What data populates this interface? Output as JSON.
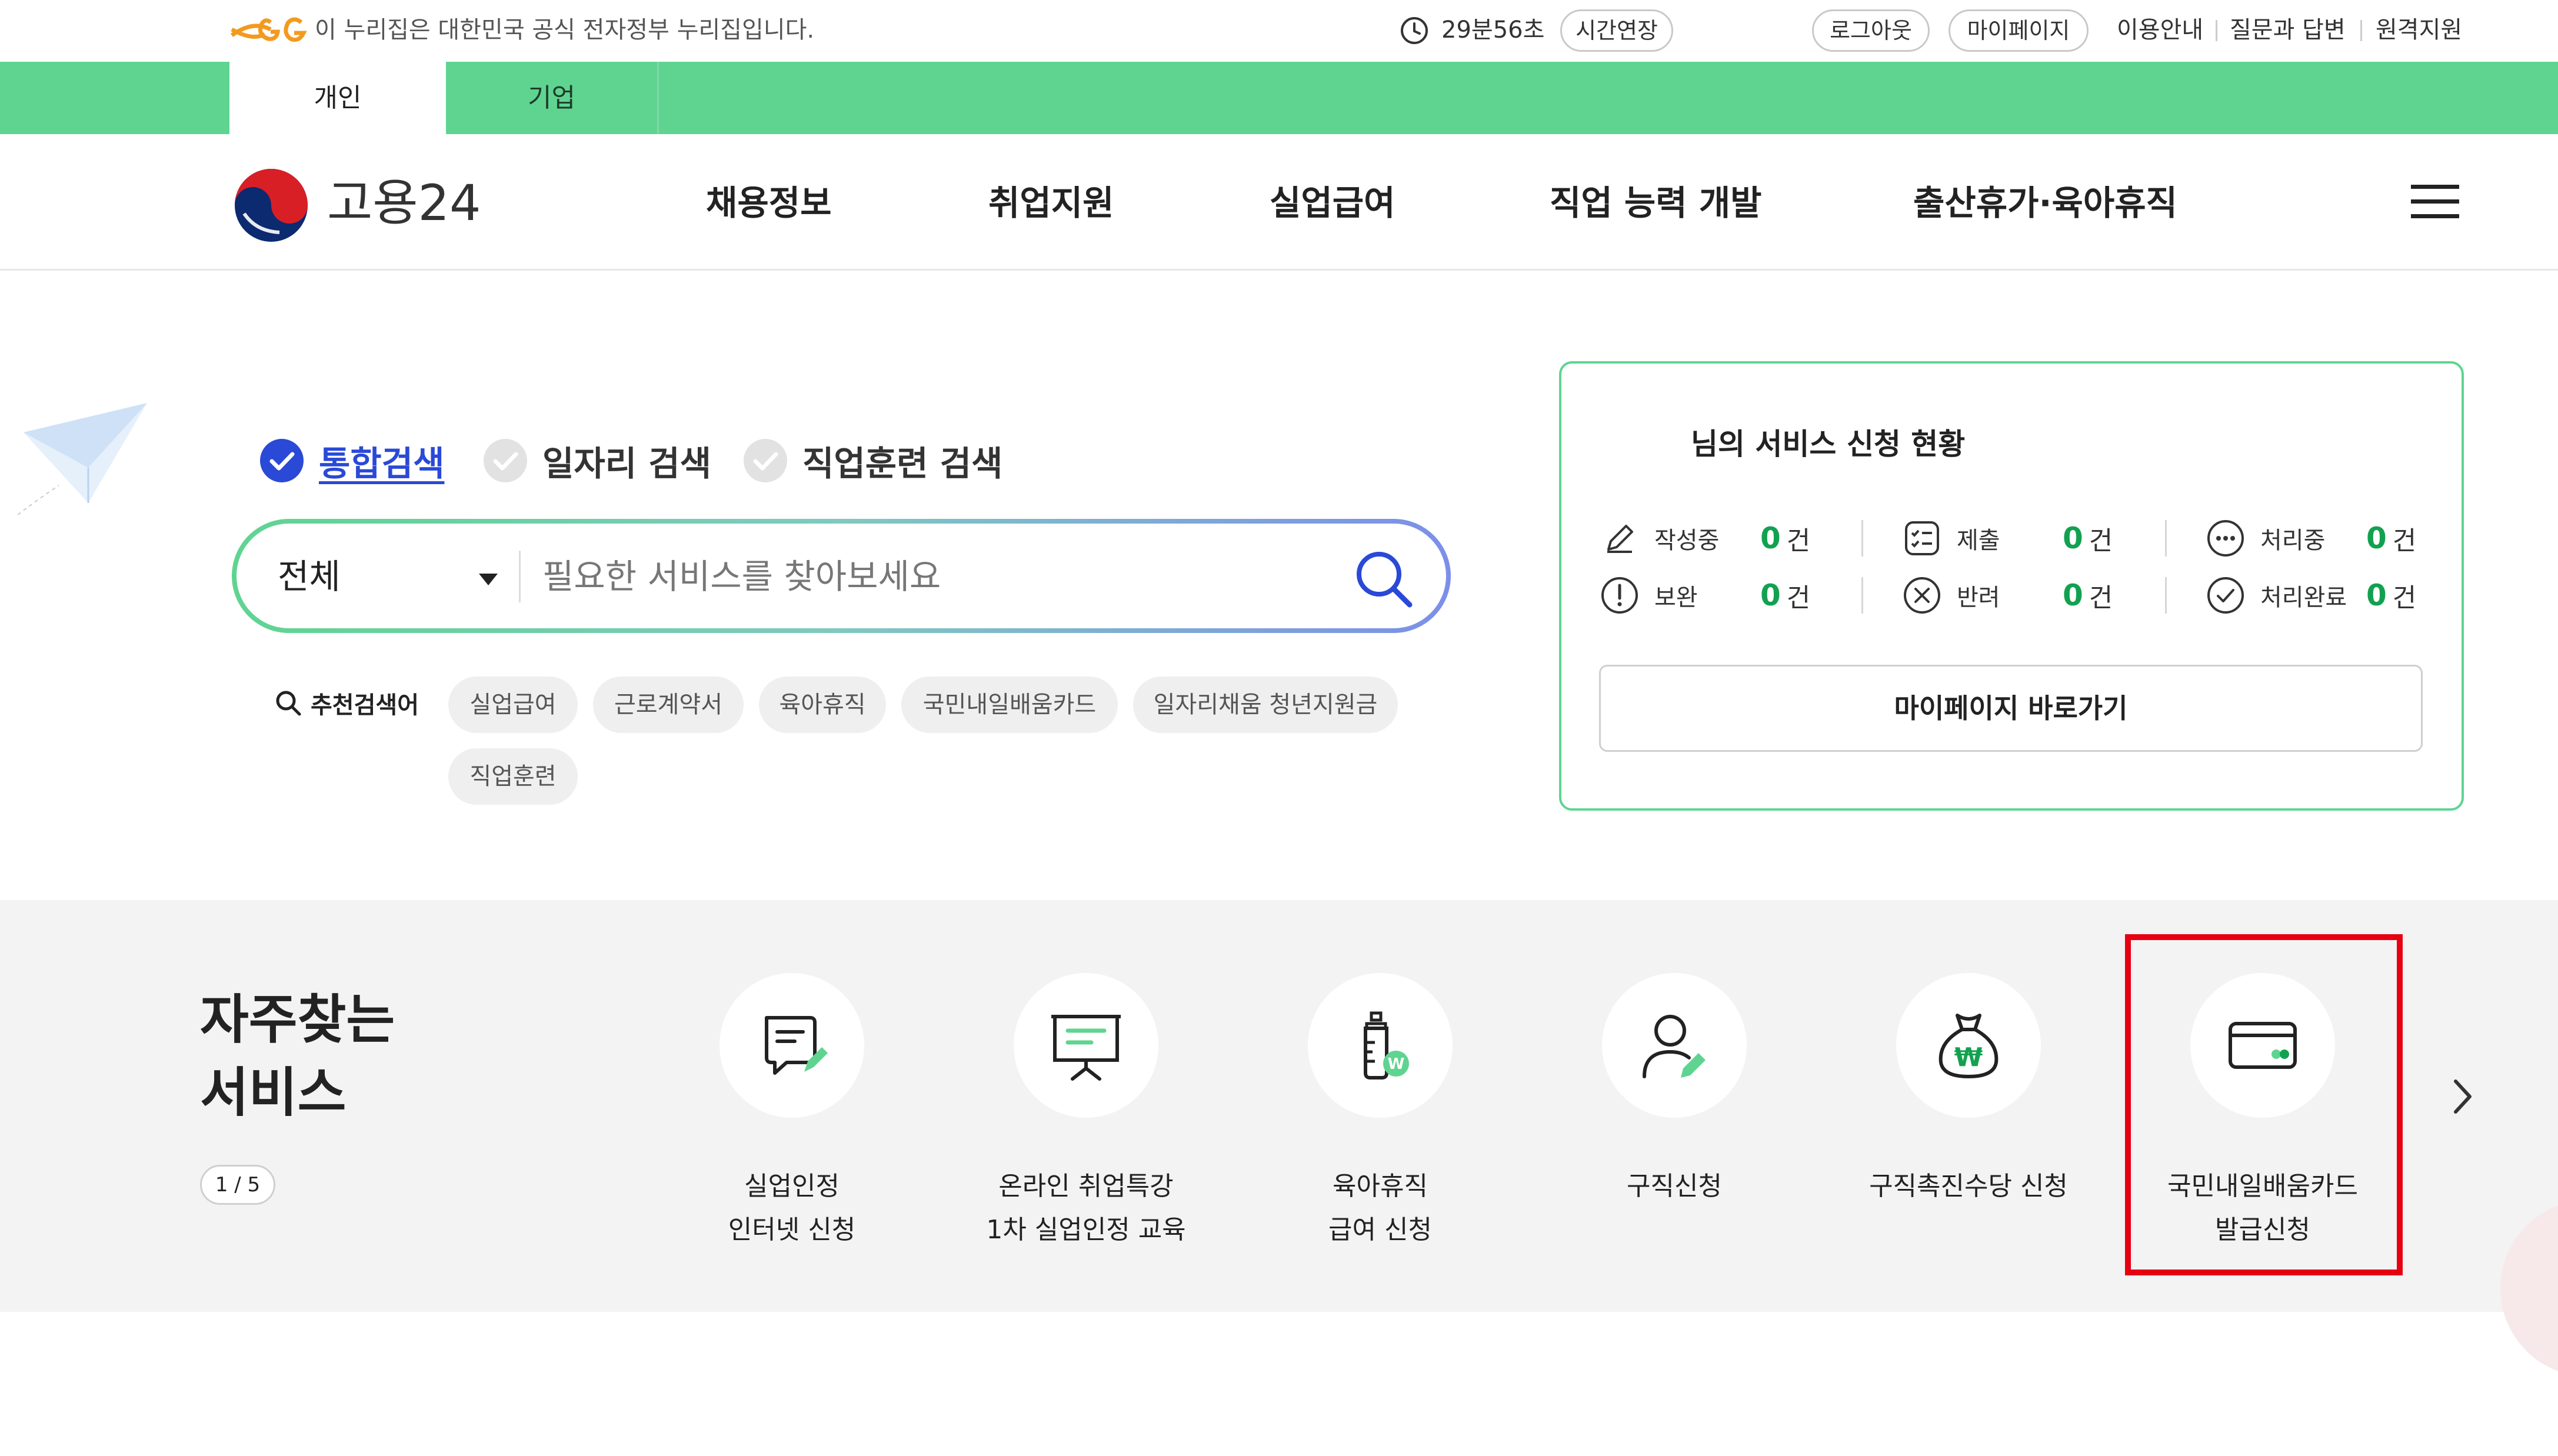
{
  "utility": {
    "notice": "이 누리집은 대한민국 공식 전자정부 누리집입니다.",
    "timer": "29분56초",
    "extend_label": "시간연장",
    "logout_label": "로그아웃",
    "mypage_label": "마이페이지",
    "guide_label": "이용안내",
    "qna_label": "질문과 답변",
    "remote_label": "원격지원"
  },
  "user_type_tabs": [
    {
      "label": "개인",
      "active": true
    },
    {
      "label": "기업",
      "active": false
    }
  ],
  "header": {
    "logo_text": "고용24",
    "nav": [
      "채용정보",
      "취업지원",
      "실업급여",
      "직업 능력 개발",
      "출산휴가·육아휴직"
    ]
  },
  "search": {
    "types": [
      {
        "label": "통합검색",
        "selected": true
      },
      {
        "label": "일자리 검색",
        "selected": false
      },
      {
        "label": "직업훈련 검색",
        "selected": false
      }
    ],
    "category_selected": "전체",
    "placeholder": "필요한 서비스를 찾아보세요",
    "recommend_label": "추천검색어",
    "recommend_terms": [
      "실업급여",
      "근로계약서",
      "육아휴직",
      "국민내일배움카드",
      "일자리채움 청년지원금",
      "직업훈련"
    ]
  },
  "status": {
    "title": "님의 서비스 신청 현황",
    "items": [
      {
        "name": "작성중",
        "count": "0",
        "unit": "건",
        "icon": "pencil-icon"
      },
      {
        "name": "제출",
        "count": "0",
        "unit": "건",
        "icon": "checklist-icon"
      },
      {
        "name": "처리중",
        "count": "0",
        "unit": "건",
        "icon": "ellipsis-icon"
      },
      {
        "name": "보완",
        "count": "0",
        "unit": "건",
        "icon": "exclamation-icon"
      },
      {
        "name": "반려",
        "count": "0",
        "unit": "건",
        "icon": "x-circle-icon"
      },
      {
        "name": "처리완료",
        "count": "0",
        "unit": "건",
        "icon": "check-circle-icon"
      }
    ],
    "mypage_button": "마이페이지 바로가기"
  },
  "services": {
    "title": "자주찾는\n서비스",
    "pager": "1 / 5",
    "items": [
      {
        "label": "실업인정\n인터넷 신청",
        "icon": "document-edit-icon"
      },
      {
        "label": "온라인 취업특강\n1차 실업인정 교육",
        "icon": "presentation-board-icon"
      },
      {
        "label": "육아휴직\n급여 신청",
        "icon": "baby-bottle-icon"
      },
      {
        "label": "구직신청",
        "icon": "person-edit-icon"
      },
      {
        "label": "구직촉진수당 신청",
        "icon": "money-bag-icon"
      },
      {
        "label": "국민내일배움카드\n발급신청",
        "icon": "card-icon",
        "highlighted": true
      }
    ]
  },
  "colors": {
    "brand_green": "#5fd491",
    "accent_blue": "#2a49d7",
    "count_green": "#12a150",
    "highlight_red": "#e60012"
  }
}
